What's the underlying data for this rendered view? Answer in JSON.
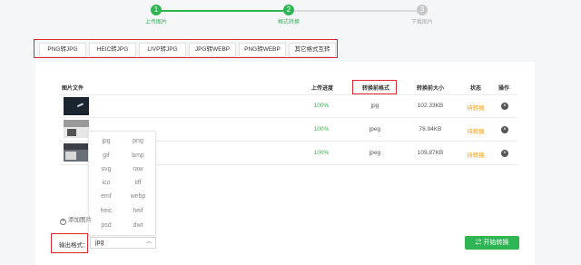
{
  "steps": [
    {
      "num": "1",
      "label": "上传图片",
      "done": true
    },
    {
      "num": "2",
      "label": "格式转换",
      "done": true
    },
    {
      "num": "3",
      "label": "下载图片",
      "done": false
    }
  ],
  "tabs": [
    "PNG转JPG",
    "HEIC转JPG",
    "LIVP转JPG",
    "JPG转WEBP",
    "PNG转WEBP",
    "其它格式互转"
  ],
  "table": {
    "headers": {
      "file": "图片文件",
      "progress": "上传进度",
      "format": "转换前格式",
      "size": "转换前大小",
      "status": "状态",
      "action": "操作"
    },
    "rows": [
      {
        "progress": "100%",
        "format": "jpg",
        "size": "102.33KB",
        "status": "待转换"
      },
      {
        "progress": "100%",
        "format": "jpeg",
        "size": "78.94KB",
        "status": "待转换"
      },
      {
        "progress": "100%",
        "format": "jpeg",
        "size": "109.87KB",
        "status": "待转换"
      }
    ]
  },
  "dropdown_options": [
    "jpg",
    "png",
    "gif",
    "bmp",
    "svg",
    "raw",
    "ico",
    "tiff",
    "emf",
    "webp",
    "heic",
    "heif",
    "psd",
    "dwt"
  ],
  "add_image": "添加图片",
  "output": {
    "label": "输出格式：",
    "value": "jpg"
  },
  "start_button": "开始转换",
  "colors": {
    "accent": "#2fb554",
    "highlight": "#e0262e",
    "pending": "#f5a11b"
  }
}
